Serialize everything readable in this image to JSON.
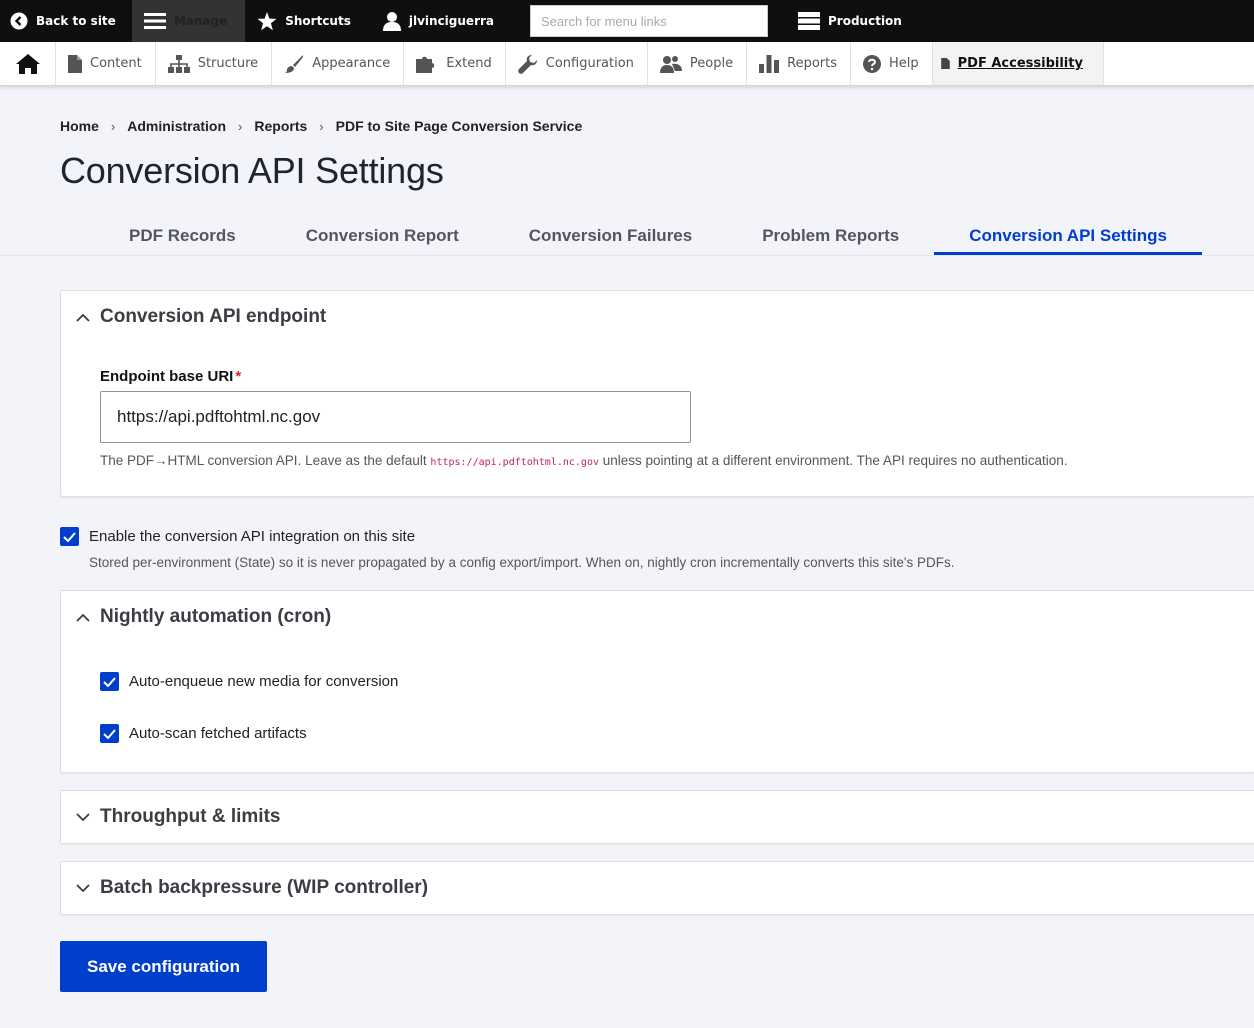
{
  "toolbar": {
    "back_label": "Back to site",
    "manage_label": "Manage",
    "shortcuts_label": "Shortcuts",
    "user_label": "jlvinciguerra",
    "search_placeholder": "Search for menu links",
    "environment_label": "Production"
  },
  "admin_menu": {
    "items": [
      {
        "label": "Content",
        "icon": "file-icon"
      },
      {
        "label": "Structure",
        "icon": "sitemap-icon"
      },
      {
        "label": "Appearance",
        "icon": "paintbrush-icon"
      },
      {
        "label": "Extend",
        "icon": "puzzle-icon"
      },
      {
        "label": "Configuration",
        "icon": "wrench-icon"
      },
      {
        "label": "People",
        "icon": "people-icon"
      },
      {
        "label": "Reports",
        "icon": "bar-chart-icon"
      },
      {
        "label": "Help",
        "icon": "help-icon"
      }
    ],
    "active_label": "PDF Accessibility"
  },
  "breadcrumb": [
    "Home",
    "Administration",
    "Reports",
    "PDF to Site Page Conversion Service"
  ],
  "page_title": "Conversion API Settings",
  "tabs": [
    {
      "label": "PDF Records",
      "active": false
    },
    {
      "label": "Conversion Report",
      "active": false
    },
    {
      "label": "Conversion Failures",
      "active": false
    },
    {
      "label": "Problem Reports",
      "active": false
    },
    {
      "label": "Conversion API Settings",
      "active": true
    }
  ],
  "endpoint_section": {
    "title": "Conversion API endpoint",
    "field_label": "Endpoint base URI",
    "required_marker": "*",
    "value": "https://api.pdftohtml.nc.gov",
    "desc_before": "The PDF→HTML conversion API. Leave as the default ",
    "desc_code": "https://api.pdftohtml.nc.gov",
    "desc_after": " unless pointing at a different environment. The API requires no authentication."
  },
  "enable_toggle": {
    "label": "Enable the conversion API integration on this site",
    "checked": true,
    "description": "Stored per-environment (State) so it is never propagated by a config export/import. When on, nightly cron incrementally converts this site's PDFs."
  },
  "cron_section": {
    "title": "Nightly automation (cron)",
    "options": [
      {
        "label": "Auto-enqueue new media for conversion",
        "checked": true
      },
      {
        "label": "Auto-scan fetched artifacts",
        "checked": true
      }
    ]
  },
  "throughput_section": {
    "title": "Throughput & limits"
  },
  "backpressure_section": {
    "title": "Batch backpressure (WIP controller)"
  },
  "save_label": "Save configuration",
  "colors": {
    "accent": "#003ecc",
    "toolbar_bg": "#0f0f0f",
    "required": "#dc2323"
  }
}
